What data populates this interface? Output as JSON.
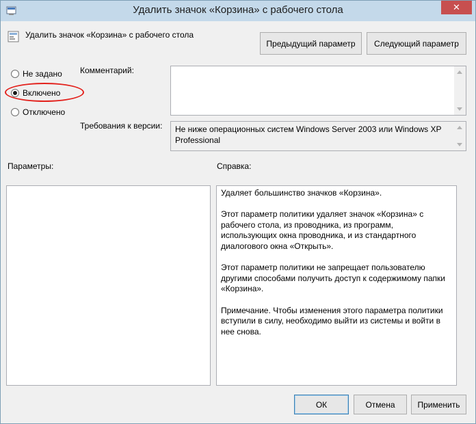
{
  "window": {
    "title": "Удалить значок «Корзина» с рабочего стола",
    "close_glyph": "✕"
  },
  "header": {
    "setting_name": "Удалить значок «Корзина» с рабочего стола",
    "prev_button": "Предыдущий параметр",
    "next_button": "Следующий параметр"
  },
  "state_options": {
    "selected": "Включено",
    "items": [
      {
        "label": "Не задано",
        "checked": false
      },
      {
        "label": "Включено",
        "checked": true
      },
      {
        "label": "Отключено",
        "checked": false
      }
    ]
  },
  "comment": {
    "label": "Комментарий:",
    "value": ""
  },
  "supported": {
    "label": "Требования к версии:",
    "value": "Не ниже операционных систем Windows Server 2003 или Windows XP Professional"
  },
  "options_panel": {
    "label": "Параметры:"
  },
  "help_panel": {
    "label": "Справка:",
    "paragraphs": [
      "Удаляет большинство значков «Корзина».",
      "Этот параметр политики удаляет значок «Корзина» с рабочего стола, из проводника, из программ, использующих окна проводника, и из стандартного диалогового окна «Открыть».",
      "Этот параметр политики не запрещает пользователю другими способами получить доступ к содержимому папки «Корзина».",
      "Примечание. Чтобы изменения этого параметра политики вступили в силу, необходимо выйти из системы и войти в нее снова."
    ]
  },
  "footer": {
    "ok": "ОК",
    "cancel": "Отмена",
    "apply": "Применить"
  },
  "colors": {
    "titlebar": "#c4d9ea",
    "close": "#c74f4f",
    "annotation": "#e3211c"
  }
}
